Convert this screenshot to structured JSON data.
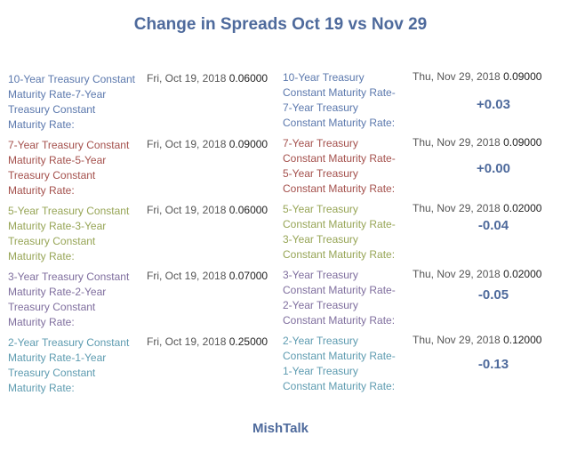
{
  "title": "Change in Spreads Oct 19 vs Nov 29",
  "footer": "MishTalk",
  "rows": [
    {
      "color": "#5b78ad",
      "left_lines": [
        "10-Year Treasury Constant",
        "Maturity Rate-7-Year",
        "Treasury Constant",
        "Maturity Rate:"
      ],
      "date1": "Fri, Oct 19, 2018",
      "value1": "0.06000",
      "right_lines": [
        "10-Year Treasury",
        "Constant Maturity Rate-",
        "7-Year Treasury",
        "Constant Maturity Rate:"
      ],
      "date2": "Thu, Nov 29, 2018",
      "value2": "0.09000",
      "change": "+0.03"
    },
    {
      "color": "#a4504c",
      "left_lines": [
        "7-Year Treasury Constant",
        "Maturity Rate-5-Year",
        "Treasury Constant",
        "Maturity Rate:"
      ],
      "date1": "Fri, Oct 19, 2018",
      "value1": "0.09000",
      "right_lines": [
        "7-Year Treasury",
        "Constant Maturity Rate-",
        "5-Year Treasury",
        "Constant Maturity Rate:"
      ],
      "date2": "Thu, Nov 29, 2018",
      "value2": "0.09000",
      "change": "+0.00"
    },
    {
      "color": "#97a556",
      "left_lines": [
        "5-Year Treasury Constant",
        "Maturity Rate-3-Year",
        "Treasury Constant",
        "Maturity Rate:"
      ],
      "date1": "Fri, Oct 19, 2018",
      "value1": "0.06000",
      "right_lines": [
        "5-Year Treasury",
        "Constant Maturity Rate-",
        "3-Year Treasury",
        "Constant Maturity Rate:"
      ],
      "date2": "Thu, Nov 29, 2018",
      "value2": "0.02000",
      "change": "-0.04"
    },
    {
      "color": "#7f6e9e",
      "left_lines": [
        "3-Year Treasury Constant",
        "Maturity Rate-2-Year",
        "Treasury Constant",
        "Maturity Rate:"
      ],
      "date1": "Fri, Oct 19, 2018",
      "value1": "0.07000",
      "right_lines": [
        "3-Year Treasury",
        "Constant Maturity Rate-",
        "2-Year Treasury",
        "Constant Maturity Rate:"
      ],
      "date2": "Thu, Nov 29, 2018",
      "value2": "0.02000",
      "change": "-0.05"
    },
    {
      "color": "#5d9bb0",
      "left_lines": [
        "2-Year Treasury Constant",
        "Maturity Rate-1-Year",
        "Treasury Constant",
        "Maturity Rate:"
      ],
      "date1": "Fri, Oct 19, 2018",
      "value1": "0.25000",
      "right_lines": [
        "2-Year Treasury",
        "Constant Maturity Rate-",
        "1-Year Treasury",
        "Constant Maturity Rate:"
      ],
      "date2": "Thu, Nov 29, 2018",
      "value2": "0.12000",
      "change": "-0.13"
    }
  ]
}
